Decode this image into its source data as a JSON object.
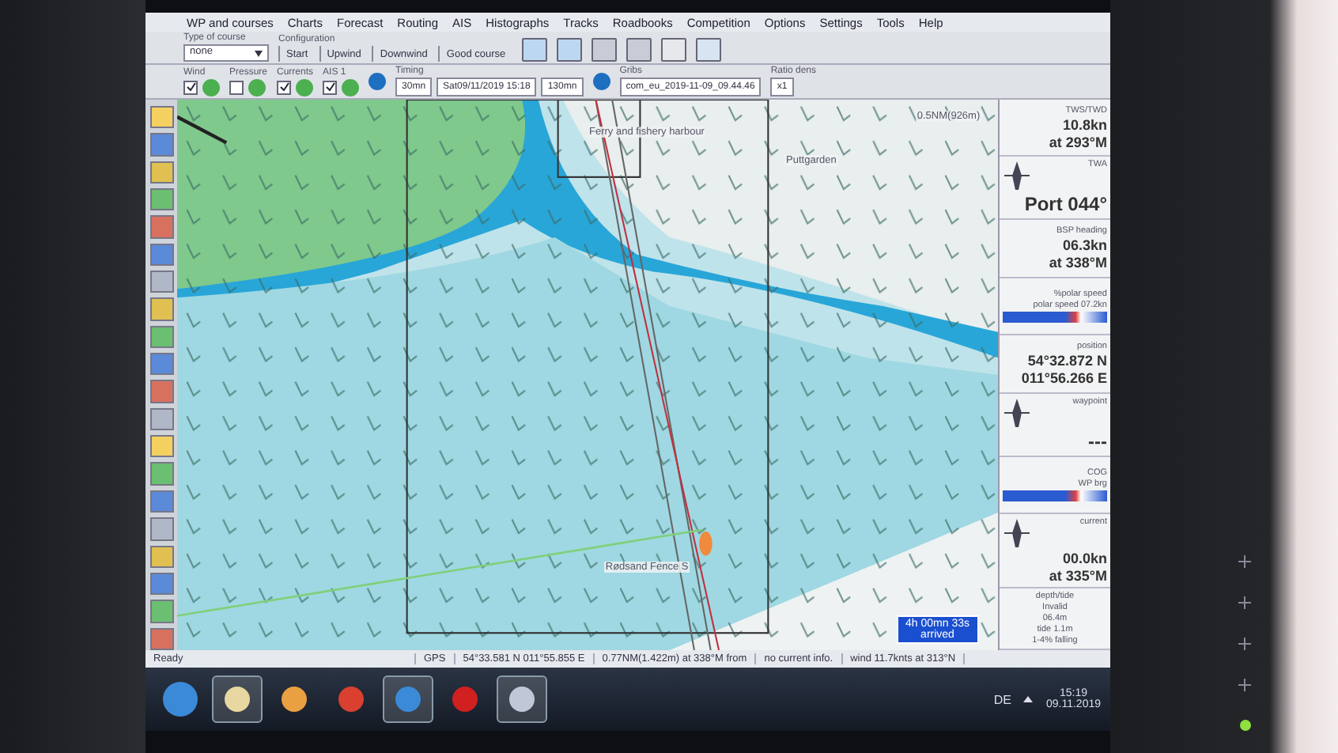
{
  "menu": [
    "WP and courses",
    "Charts",
    "Forecast",
    "Routing",
    "AIS",
    "Histographs",
    "Tracks",
    "Roadbooks",
    "Competition",
    "Options",
    "Settings",
    "Tools",
    "Help"
  ],
  "course": {
    "label": "Type of course",
    "value": "none"
  },
  "configuration": {
    "label": "Configuration",
    "buttons": [
      "Start",
      "Upwind",
      "Downwind",
      "Good course"
    ]
  },
  "layers": [
    {
      "label": "Wind",
      "checked": true
    },
    {
      "label": "Pressure",
      "checked": false
    },
    {
      "label": "Currents",
      "checked": true
    },
    {
      "label": "AIS 1",
      "checked": true
    }
  ],
  "timing": {
    "label": "Timing",
    "step": "30mn",
    "time": "Sat09/11/2019 15:18",
    "offset": "130mn"
  },
  "gribs": {
    "label": "Gribs",
    "file": "com_eu_2019-11-09_09.44.46"
  },
  "ratio": {
    "label": "Ratio dens",
    "value": "x1"
  },
  "map": {
    "labels": [
      "Ferry and fishery harbour",
      "Puttgarden",
      "Rødsand Fence S"
    ],
    "scale": "0.5NM(926m)",
    "eta": {
      "time": "4h 00mn 33s",
      "status": "arrived"
    }
  },
  "instruments": [
    {
      "kind": "reading",
      "label": "TWS/TWD",
      "lines": [
        "10.8kn",
        "at 293°M"
      ]
    },
    {
      "kind": "reading",
      "label": "TWA",
      "lines": [
        "Port 044°"
      ]
    },
    {
      "kind": "reading",
      "label": "BSP heading",
      "lines": [
        "06.3kn",
        "at 338°M"
      ]
    },
    {
      "kind": "gauge",
      "label": "%polar speed",
      "lines": [
        "polar speed 07.2kn"
      ]
    },
    {
      "kind": "reading",
      "label": "position",
      "lines": [
        "54°32.872 N",
        "011°56.266 E"
      ]
    },
    {
      "kind": "reading",
      "label": "waypoint",
      "lines": [
        "---"
      ]
    },
    {
      "kind": "gauge",
      "label": "COG",
      "lines": [
        "WP brg"
      ]
    },
    {
      "kind": "reading",
      "label": "current",
      "lines": [
        "00.0kn",
        "at 335°M"
      ]
    },
    {
      "kind": "notes",
      "label": "depth/tide",
      "lines": [
        "Invalid",
        "06.4m",
        "tide 1.1m",
        "1-4% falling"
      ]
    }
  ],
  "status_bar": {
    "state": "Ready",
    "source": "GPS",
    "position": "54°33.581 N  011°55.855 E",
    "distance": "0.77NM(1.422m) at 338°M from",
    "current": "no current info.",
    "wind": "wind 11.7knts at 313°N"
  },
  "taskbar": {
    "language": "DE",
    "time": "15:19",
    "date": "09.11.2019"
  }
}
